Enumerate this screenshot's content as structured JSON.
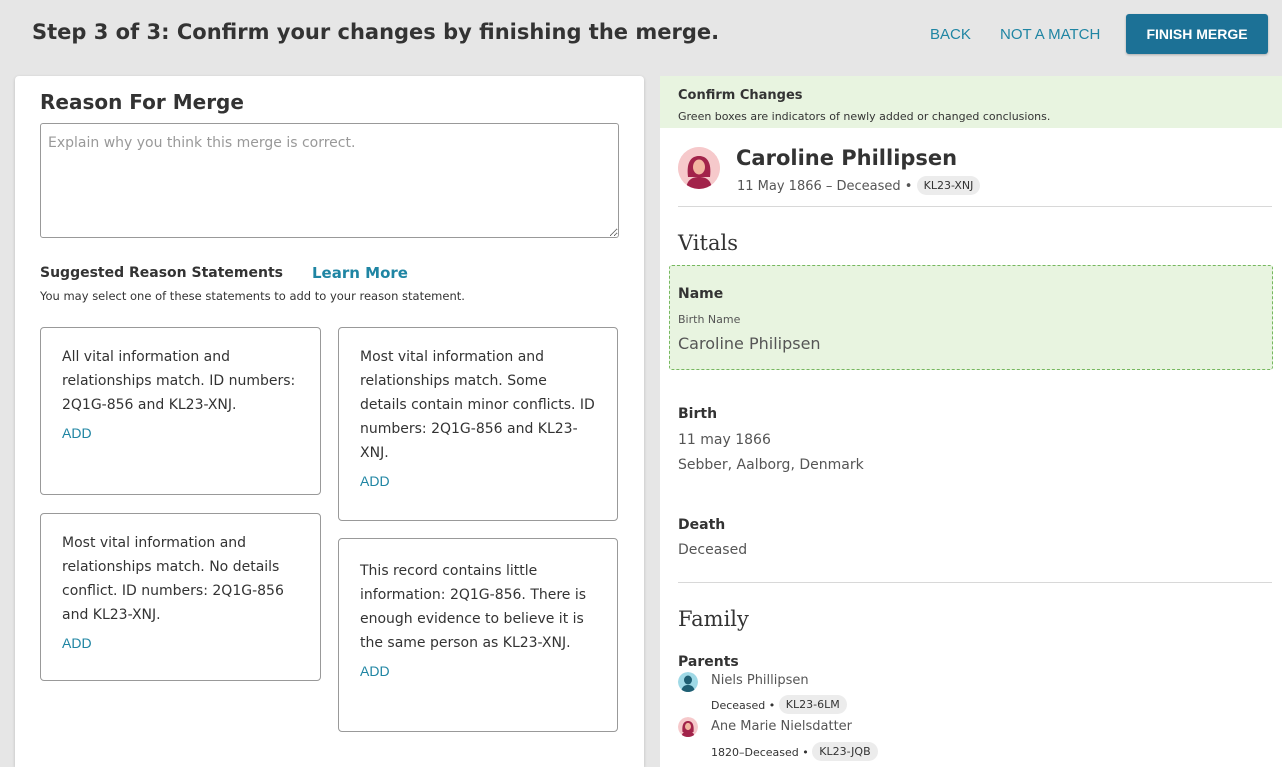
{
  "header": {
    "step_title": "Step 3 of 3: Confirm your changes by finishing the merge.",
    "back_label": "BACK",
    "not_match_label": "NOT A MATCH",
    "finish_label": "FINISH MERGE"
  },
  "reason": {
    "title": "Reason For Merge",
    "placeholder": "Explain why you think this merge is correct.",
    "suggest_title": "Suggested Reason Statements",
    "learn_more": "Learn More",
    "suggest_sub": "You may select one of these statements to add to your reason statement.",
    "statements": [
      {
        "text": "All vital information and relationships match. ID numbers: 2Q1G-856 and KL23-XNJ.",
        "add": "ADD"
      },
      {
        "text": "Most vital information and relationships match. Some details contain minor conflicts. ID numbers: 2Q1G-856 and KL23-XNJ.",
        "add": "ADD"
      },
      {
        "text": "Most vital information and relationships match. No details conflict. ID numbers: 2Q1G-856 and KL23-XNJ.",
        "add": "ADD"
      },
      {
        "text": "This record contains little information: 2Q1G-856. There is enough evidence to believe it is the same person as KL23-XNJ.",
        "add": "ADD"
      }
    ]
  },
  "confirm": {
    "title": "Confirm Changes",
    "subtitle": "Green boxes are indicators of newly added or changed conclusions.",
    "person": {
      "name": "Caroline Phillipsen",
      "lifespan": "11 May 1866 – Deceased •",
      "id": "KL23-XNJ"
    },
    "vitals": {
      "title": "Vitals",
      "name_label": "Name",
      "name_type": "Birth Name",
      "name_value": "Caroline Philipsen",
      "birth_label": "Birth",
      "birth_date": "11 may 1866",
      "birth_place": "Sebber, Aalborg, Denmark",
      "death_label": "Death",
      "death_value": "Deceased"
    },
    "family": {
      "title": "Family",
      "parents_label": "Parents",
      "parents": [
        {
          "name": "Niels Phillipsen",
          "meta": "Deceased •",
          "id": "KL23-6LM"
        },
        {
          "name": "Ane Marie Nielsdatter",
          "meta": "1820–Deceased •",
          "id": "KL23-JQB"
        }
      ]
    }
  },
  "colors": {
    "accent": "#1f85a3",
    "primary_button": "#1c7196",
    "changed_bg": "#e8f4e0",
    "changed_border": "#76b85f"
  }
}
